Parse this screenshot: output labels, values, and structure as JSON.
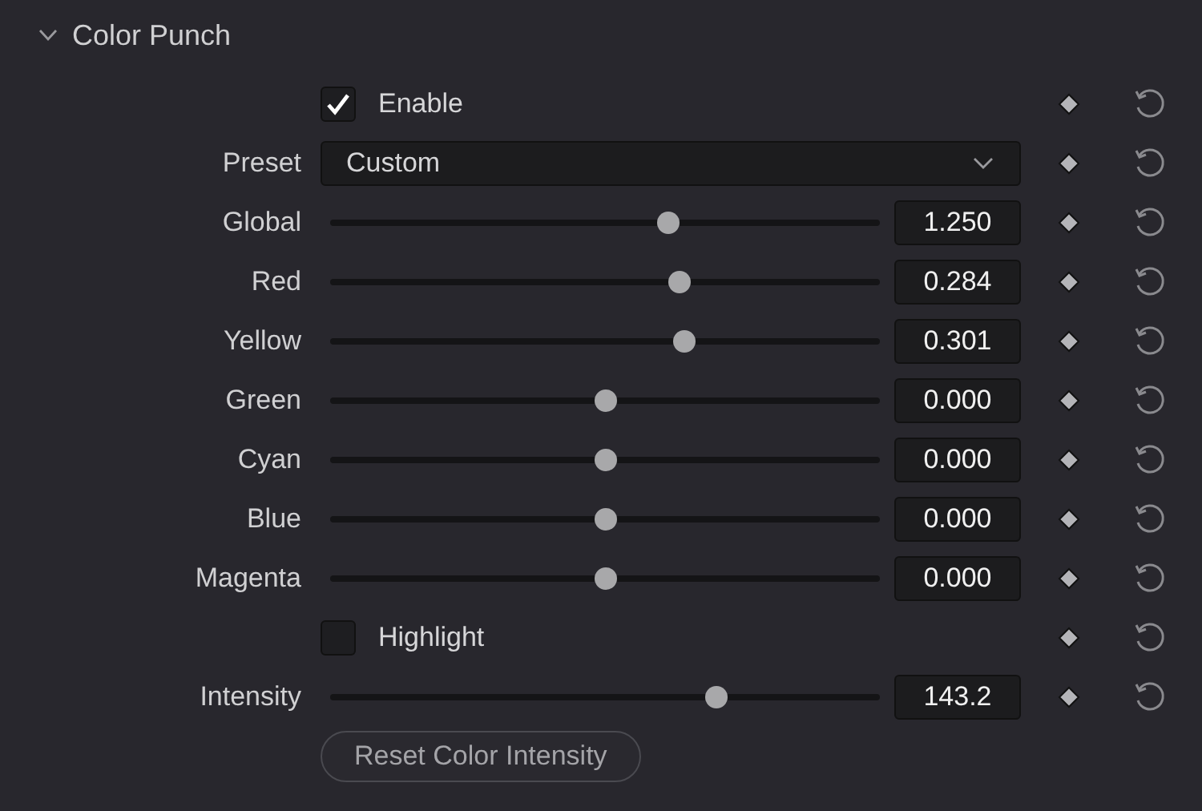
{
  "section": {
    "title": "Color Punch",
    "expanded": true
  },
  "rows": [
    {
      "kind": "checkbox",
      "label": "Enable",
      "checked": true
    },
    {
      "kind": "dropdown",
      "label": "Preset",
      "value": "Custom"
    },
    {
      "kind": "slider",
      "label": "Global",
      "level": 0.62,
      "value": "1.250"
    },
    {
      "kind": "slider",
      "label": "Red",
      "level": 0.64,
      "value": "0.284"
    },
    {
      "kind": "slider",
      "label": "Yellow",
      "level": 0.65,
      "value": "0.301"
    },
    {
      "kind": "slider",
      "label": "Green",
      "level": 0.5,
      "value": "0.000"
    },
    {
      "kind": "slider",
      "label": "Cyan",
      "level": 0.5,
      "value": "0.000"
    },
    {
      "kind": "slider",
      "label": "Blue",
      "level": 0.5,
      "value": "0.000"
    },
    {
      "kind": "slider",
      "label": "Magenta",
      "level": 0.5,
      "value": "0.000"
    },
    {
      "kind": "checkbox",
      "label": "Highlight",
      "checked": false
    },
    {
      "kind": "slider",
      "label": "Intensity",
      "level": 0.71,
      "value": "143.2"
    }
  ],
  "reset_button": "Reset Color Intensity"
}
